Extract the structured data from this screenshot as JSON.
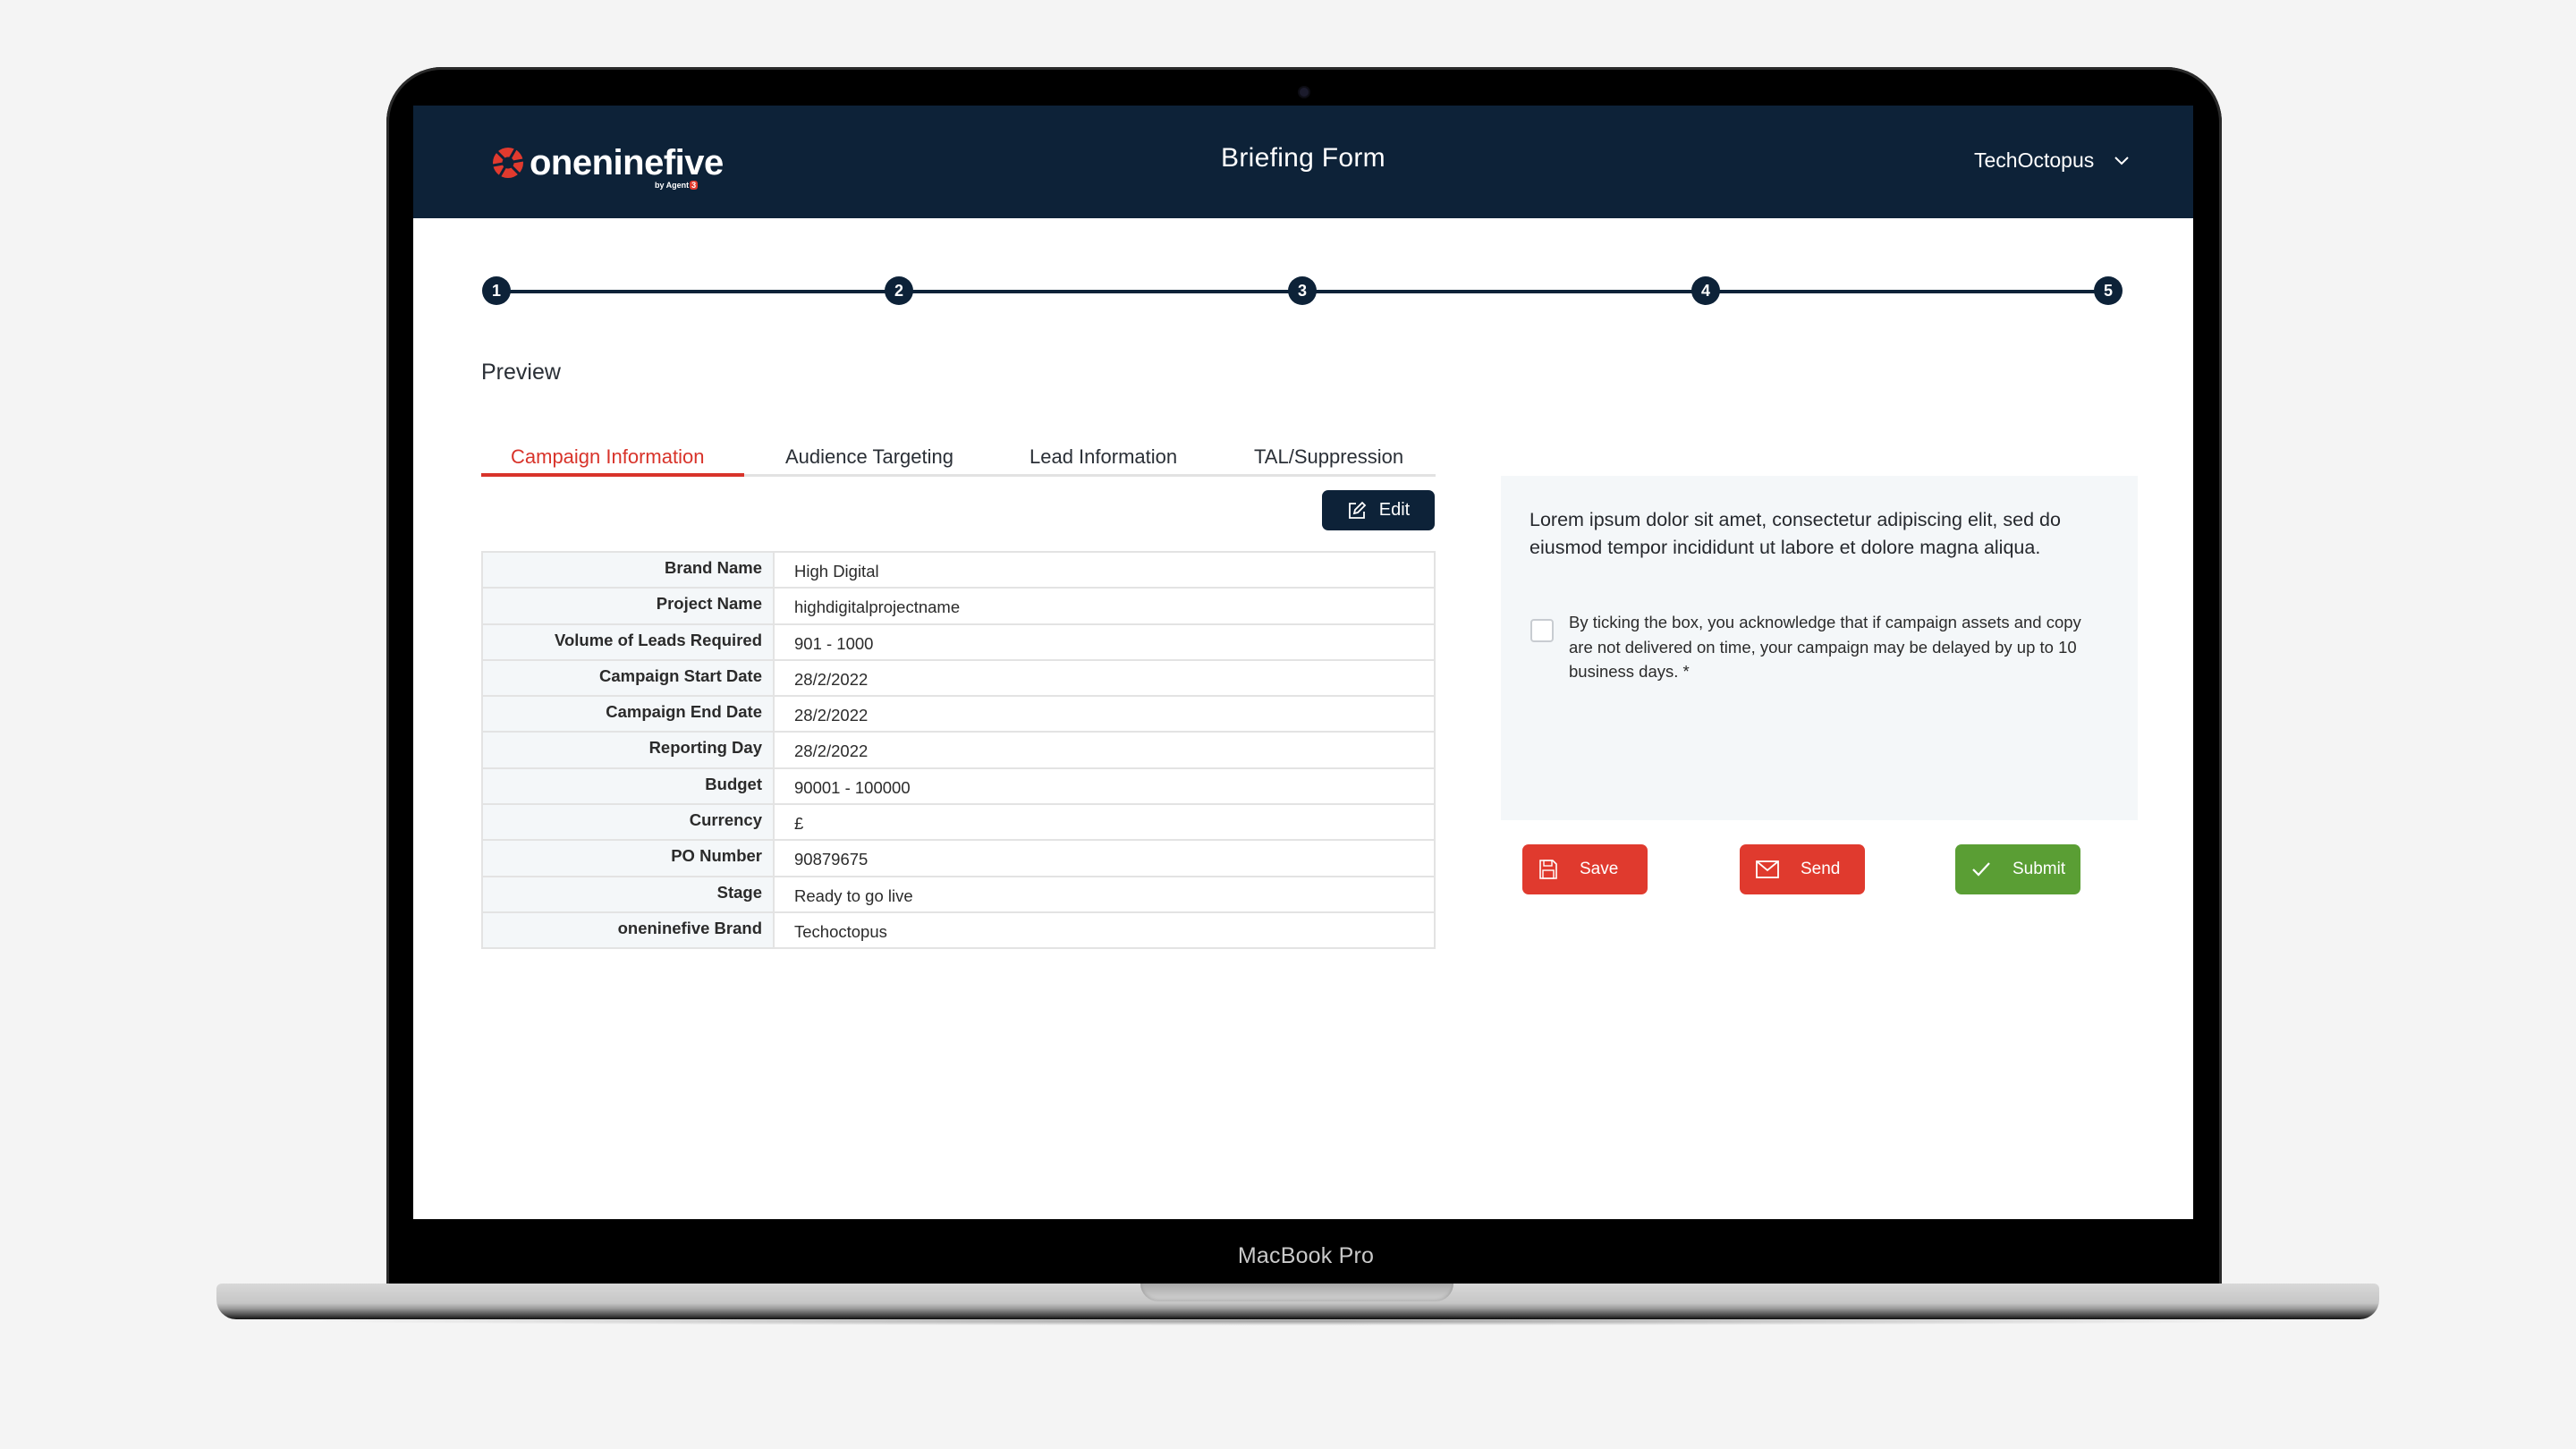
{
  "device": {
    "label": "MacBook Pro"
  },
  "header": {
    "brand": "oneninefive",
    "brand_byline": "by Agent",
    "brand_byline_badge": "3",
    "title": "Briefing Form",
    "account": "TechOctopus",
    "colors": {
      "header_bg": "#0d2238",
      "brand_red": "#e13a2e"
    }
  },
  "stepper": {
    "steps": [
      "1",
      "2",
      "3",
      "4",
      "5"
    ]
  },
  "page": {
    "title": "Preview"
  },
  "tabs": [
    {
      "label": "Campaign Information",
      "active": true
    },
    {
      "label": "Audience Targeting",
      "active": false
    },
    {
      "label": "Lead Information",
      "active": false
    },
    {
      "label": "TAL/Suppression",
      "active": false
    }
  ],
  "edit_button": {
    "label": "Edit",
    "icon": "edit-icon"
  },
  "table": {
    "rows": [
      {
        "label": "Brand Name",
        "value": "High Digital"
      },
      {
        "label": "Project Name",
        "value": "highdigitalprojectname"
      },
      {
        "label": "Volume of Leads Required",
        "value": "901 - 1000"
      },
      {
        "label": "Campaign Start Date",
        "value": "28/2/2022"
      },
      {
        "label": "Campaign End Date",
        "value": "28/2/2022"
      },
      {
        "label": "Reporting Day",
        "value": "28/2/2022"
      },
      {
        "label": "Budget",
        "value": "90001 - 100000"
      },
      {
        "label": "Currency",
        "value": "£"
      },
      {
        "label": "PO Number",
        "value": "90879675"
      },
      {
        "label": "Stage",
        "value": "Ready to go live"
      },
      {
        "label": "oneninefive Brand",
        "value": "Techoctopus"
      }
    ]
  },
  "panel": {
    "intro": "Lorem ipsum dolor sit amet, consectetur adipiscing elit, sed do eiusmod tempor incididunt ut labore et dolore magna aliqua.",
    "acknowledge": {
      "checked": false,
      "text": "By ticking the box, you acknowledge that if campaign assets and copy are not delivered on time, your campaign may be delayed by up to 10 business days.  *"
    },
    "buttons": [
      {
        "label": "Save",
        "icon": "save-icon",
        "color": "#e03a2e"
      },
      {
        "label": "Send",
        "icon": "mail-icon",
        "color": "#e03a2e"
      },
      {
        "label": "Submit",
        "icon": "check-icon",
        "color": "#5a9e34"
      }
    ]
  }
}
